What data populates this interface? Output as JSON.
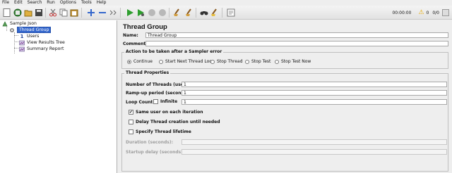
{
  "menu": [
    "File",
    "Edit",
    "Search",
    "Run",
    "Options",
    "Tools",
    "Help"
  ],
  "toolbar": {
    "icons": [
      "new-icon",
      "templates-icon",
      "open-icon",
      "save-icon",
      "cut-icon",
      "copy-icon",
      "paste-icon",
      "expand-icon",
      "collapse-icon",
      "toggle-icon",
      "start-icon",
      "start-no-pause-icon",
      "stop-icon",
      "shutdown-icon",
      "clear-icon",
      "clear-all-icon",
      "search-icon",
      "reset-search-icon",
      "function-helper-icon"
    ],
    "timer": "00:00:00",
    "warnings": "0",
    "threads": "0/0"
  },
  "tree": {
    "root": "Sample Json",
    "thread_group": "Thread Group",
    "children": [
      "Users",
      "View Results Tree",
      "Summary Report"
    ]
  },
  "panel": {
    "title": "Thread Group",
    "name_label": "Name:",
    "name_value": "Thread Group",
    "comments_label": "Comments:",
    "comments_value": "",
    "error_action": {
      "title": "Action to be taken after a Sampler error",
      "options": [
        "Continue",
        "Start Next Thread Loop",
        "Stop Thread",
        "Stop Test",
        "Stop Test Now"
      ],
      "selected": "Continue"
    },
    "thread_props": {
      "title": "Thread Properties",
      "threads_label": "Number of Threads (users):",
      "threads_value": "1",
      "rampup_label": "Ramp-up period (seconds):",
      "rampup_value": "1",
      "loop_label": "Loop Count:",
      "infinite_label": "Infinite",
      "loop_value": "1",
      "same_user_label": "Same user on each iteration",
      "delay_label": "Delay Thread creation until needed",
      "lifetime_label": "Specify Thread lifetime",
      "duration_label": "Duration (seconds):",
      "startup_label": "Startup delay (seconds):"
    }
  }
}
